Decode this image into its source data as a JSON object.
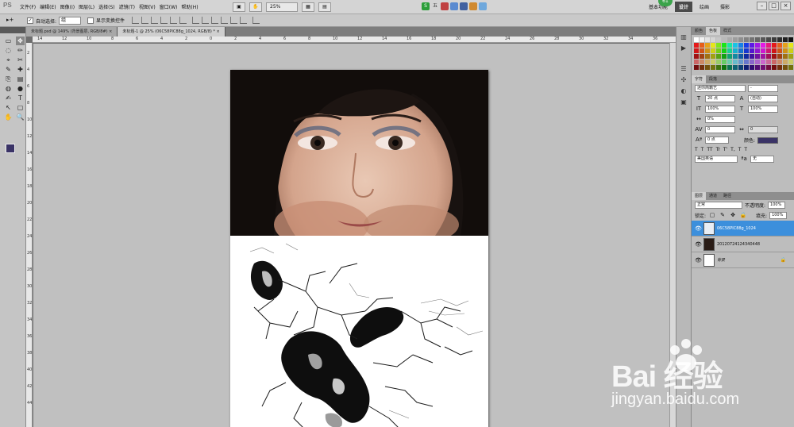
{
  "menubar": {
    "logo": "PS",
    "items": [
      "文件(F)",
      "编辑(E)",
      "图像(I)",
      "图层(L)",
      "选择(S)",
      "滤镜(T)",
      "视图(V)",
      "窗口(W)",
      "帮助(H)"
    ],
    "zoom": "25%",
    "workspaces": [
      "基本功能",
      "设计",
      "绘画",
      "摄影"
    ],
    "active_workspace": "设计",
    "badge": "61",
    "window_controls": [
      "–",
      "□",
      "×"
    ]
  },
  "options": {
    "move_icon": "▸+",
    "auto_select_label": "自动选择:",
    "auto_select_value": "组",
    "show_transform_label": "显示变换控件"
  },
  "tools": {
    "items": [
      "▭",
      "✥",
      "◌",
      "✏",
      "⌖",
      "✂",
      "✎",
      "✚",
      "⎘",
      "▤",
      "◍",
      "●",
      "✍",
      "T",
      "↖",
      "▢",
      "✋",
      "🔍"
    ],
    "fg_color": "#3a3366",
    "bg_color": "#ffffff"
  },
  "doc_tabs": [
    {
      "label": "未标题.psd @ 149% (背景图层, RGB/8#) ×",
      "active": false
    },
    {
      "label": "未标题-1 @ 25% (06C58PIC88g_1024, RGB/8) * ×",
      "active": true
    }
  ],
  "ruler_h": [
    "14",
    "12",
    "10",
    "8",
    "6",
    "4",
    "2",
    "0",
    "2",
    "4",
    "6",
    "8",
    "10",
    "12",
    "14",
    "16",
    "18",
    "20",
    "22",
    "24",
    "26",
    "28",
    "30",
    "32",
    "34",
    "36"
  ],
  "ruler_v": [
    "2",
    "4",
    "6",
    "8",
    "10",
    "12",
    "14",
    "16",
    "18",
    "20",
    "22",
    "24",
    "26",
    "28",
    "30",
    "32",
    "34",
    "36",
    "38",
    "40",
    "42",
    "44"
  ],
  "panels": {
    "swatch_tabs": [
      "颜色",
      "色板",
      "样式"
    ],
    "char_tabs": [
      "字符",
      "段落"
    ],
    "font_family": "迷你简籍艺",
    "font_style": "-",
    "font_size": "20 点",
    "leading": "(自动)",
    "vscale": "100%",
    "hscale": "100%",
    "tracking": "0%",
    "kerning": "0",
    "baseline": "0 点",
    "color_label": "颜色:",
    "language": "美国英语",
    "aa_value": "无",
    "text_style_buttons": [
      "T",
      "T",
      "TT",
      "Tr",
      "T'",
      "T,",
      "T",
      "T"
    ],
    "layer_tabs": [
      "图层",
      "通道",
      "路径"
    ],
    "blend_mode": "正常",
    "opacity_label": "不透明度:",
    "opacity": "100%",
    "lock_label": "锁定:",
    "fill_label": "填充:",
    "fill": "100%",
    "layers": [
      {
        "name": "06C58PIC88g_1024",
        "active": true
      },
      {
        "name": "20120724124340448",
        "active": false
      },
      {
        "name": "背景",
        "active": false
      }
    ]
  },
  "watermark": {
    "main": "Bai 经验",
    "sub": "jingyan.baidu.com"
  }
}
